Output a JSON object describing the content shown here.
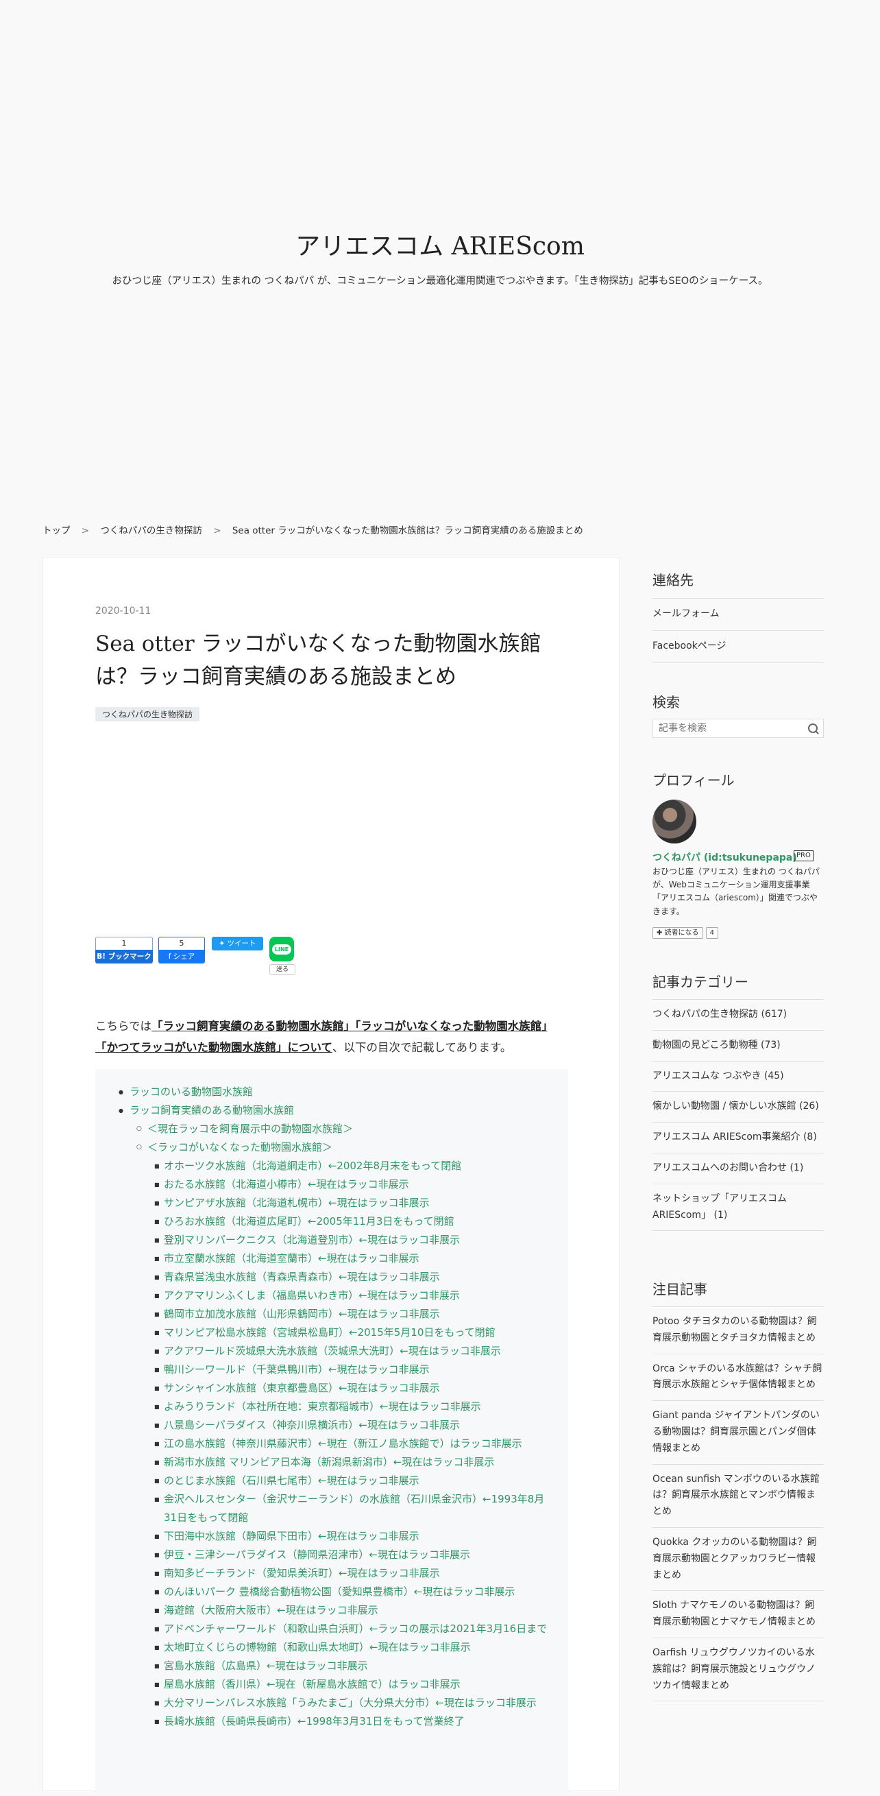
{
  "site": {
    "title": "アリエスコム ARIEScom",
    "description": "おひつじ座（アリエス）生まれの つくねパパ が、コミュニケーション最適化運用関連でつぶやきます。「生き物探訪」記事もSEOのショーケース。"
  },
  "breadcrumb": {
    "items": [
      "トップ",
      "つくねパパの生き物探訪",
      "Sea otter ラッコがいなくなった動物園水族館は？ラッコ飼育実績のある施設まとめ"
    ],
    "separator": ">"
  },
  "article": {
    "date": "2020-10-11",
    "title": "Sea otter ラッコがいなくなった動物園水族館は？ラッコ飼育実績のある施設まとめ",
    "category": "つくねパパの生き物探訪",
    "share": {
      "hatena_count": "1",
      "hatena_label": "B! ブックマーク",
      "facebook_count": "5",
      "facebook_label": "f  シェア",
      "twitter_label": "ツイート",
      "line_icon": "LINE",
      "line_label": "送る"
    },
    "intro": {
      "prefix": "こちらでは",
      "link": "「ラッコ飼育実績のある動物園水族館」「ラッコがいなくなった動物園水族館」「かつてラッコがいた動物園水族館」について",
      "suffix": "、以下の目次で記載してあります。"
    },
    "toc": [
      {
        "level": 1,
        "text": "ラッコのいる動物園水族館"
      },
      {
        "level": 1,
        "text": "ラッコ飼育実績のある動物園水族館"
      },
      {
        "level": 2,
        "text": "＜現在ラッコを飼育展示中の動物園水族館＞"
      },
      {
        "level": 2,
        "text": "＜ラッコがいなくなった動物園水族館＞"
      },
      {
        "level": 3,
        "text": "オホーツク水族館（北海道網走市）←2002年8月末をもって閉館"
      },
      {
        "level": 3,
        "text": "おたる水族館（北海道小樽市）←現在はラッコ非展示"
      },
      {
        "level": 3,
        "text": "サンピアザ水族館（北海道札幌市）←現在はラッコ非展示"
      },
      {
        "level": 3,
        "text": "ひろお水族館（北海道広尾町）←2005年11月3日をもって閉館"
      },
      {
        "level": 3,
        "text": "登別マリンパークニクス（北海道登別市）←現在はラッコ非展示"
      },
      {
        "level": 3,
        "text": "市立室蘭水族館（北海道室蘭市）←現在はラッコ非展示"
      },
      {
        "level": 3,
        "text": "青森県営浅虫水族館（青森県青森市）←現在はラッコ非展示"
      },
      {
        "level": 3,
        "text": "アクアマリンふくしま（福島県いわき市）←現在はラッコ非展示"
      },
      {
        "level": 3,
        "text": "鶴岡市立加茂水族館（山形県鶴岡市）←現在はラッコ非展示"
      },
      {
        "level": 3,
        "text": "マリンピア松島水族館（宮城県松島町）←2015年5月10日をもって閉館"
      },
      {
        "level": 3,
        "text": "アクアワールド茨城県大洗水族館（茨城県大洗町）←現在はラッコ非展示"
      },
      {
        "level": 3,
        "text": "鴨川シーワールド（千葉県鴨川市）←現在はラッコ非展示"
      },
      {
        "level": 3,
        "text": "サンシャイン水族館（東京都豊島区）←現在はラッコ非展示"
      },
      {
        "level": 3,
        "text": "よみうりランド（本社所在地：東京都稲城市）←現在はラッコ非展示"
      },
      {
        "level": 3,
        "text": "八景島シーパラダイス（神奈川県横浜市）←現在はラッコ非展示"
      },
      {
        "level": 3,
        "text": "江の島水族館（神奈川県藤沢市）←現在（新江ノ島水族館で）はラッコ非展示"
      },
      {
        "level": 3,
        "text": "新潟市水族館 マリンピア日本海（新潟県新潟市）←現在はラッコ非展示"
      },
      {
        "level": 3,
        "text": "のとじま水族館（石川県七尾市）←現在はラッコ非展示"
      },
      {
        "level": 3,
        "text": "金沢ヘルスセンター（金沢サニーランド）の水族館（石川県金沢市）←1993年8月31日をもって閉館"
      },
      {
        "level": 3,
        "text": "下田海中水族館（静岡県下田市）←現在はラッコ非展示"
      },
      {
        "level": 3,
        "text": "伊豆・三津シーパラダイス（静岡県沼津市）←現在はラッコ非展示"
      },
      {
        "level": 3,
        "text": "南知多ビーチランド（愛知県美浜町）←現在はラッコ非展示"
      },
      {
        "level": 3,
        "text": "のんほいパーク 豊橋総合動植物公園（愛知県豊橋市）←現在はラッコ非展示"
      },
      {
        "level": 3,
        "text": "海遊館（大阪府大阪市）←現在はラッコ非展示"
      },
      {
        "level": 3,
        "text": "アドベンチャーワールド（和歌山県白浜町）←ラッコの展示は2021年3月16日まで"
      },
      {
        "level": 3,
        "text": "太地町立くじらの博物館（和歌山県太地町）←現在はラッコ非展示"
      },
      {
        "level": 3,
        "text": "宮島水族館（広島県）←現在はラッコ非展示"
      },
      {
        "level": 3,
        "text": "屋島水族館（香川県）←現在（新屋島水族館で）はラッコ非展示"
      },
      {
        "level": 3,
        "text": "大分マリーンパレス水族館「うみたまご」（大分県大分市）←現在はラッコ非展示"
      },
      {
        "level": 3,
        "text": "長崎水族館（長崎県長崎市）←1998年3月31日をもって営業終了"
      }
    ]
  },
  "sidebar": {
    "contact": {
      "heading": "連絡先",
      "items": [
        "メールフォーム",
        "Facebookページ"
      ]
    },
    "search": {
      "heading": "検索",
      "placeholder": "記事を検索"
    },
    "profile": {
      "heading": "プロフィール",
      "name": "つくねパパ (id:tsukunepapa)",
      "badge": "PRO",
      "text": "おひつじ座（アリエス）生まれの つくねパパ が、Webコミュニケーション運用支援事業「アリエスコム（ariescom）」関連でつぶやきます。",
      "follow_label": "✚ 読者になる",
      "follow_count": "4"
    },
    "categories": {
      "heading": "記事カテゴリー",
      "items": [
        "つくねパパの生き物探訪 (617)",
        "動物園の見どころ動物種 (73)",
        "アリエスコムな つぶやき (45)",
        "懐かしい動物園 / 懐かしい水族館 (26)",
        "アリエスコム ARIEScom事業紹介 (8)",
        "アリエスコムへのお問い合わせ (1)",
        "ネットショップ「アリエスコム ARIEScom」 (1)"
      ]
    },
    "featured": {
      "heading": "注目記事",
      "items": [
        "Potoo タチヨタカのいる動物園は？飼育展示動物園とタチヨタカ情報まとめ",
        "Orca シャチのいる水族館は？シャチ飼育展示水族館とシャチ個体情報まとめ",
        "Giant panda ジャイアントパンダのいる動物園は？飼育展示園とパンダ個体情報まとめ",
        "Ocean sunfish マンボウのいる水族館は？飼育展示水族館とマンボウ情報まとめ",
        "Quokka クオッカのいる動物園は？飼育展示動物園とクアッカワラビー情報まとめ",
        "Sloth ナマケモノのいる動物園は？飼育展示動物園とナマケモノ情報まとめ",
        "Oarfish リュウグウノツカイのいる水族館は？飼育展示施設とリュウグウノツカイ情報まとめ"
      ]
    }
  }
}
